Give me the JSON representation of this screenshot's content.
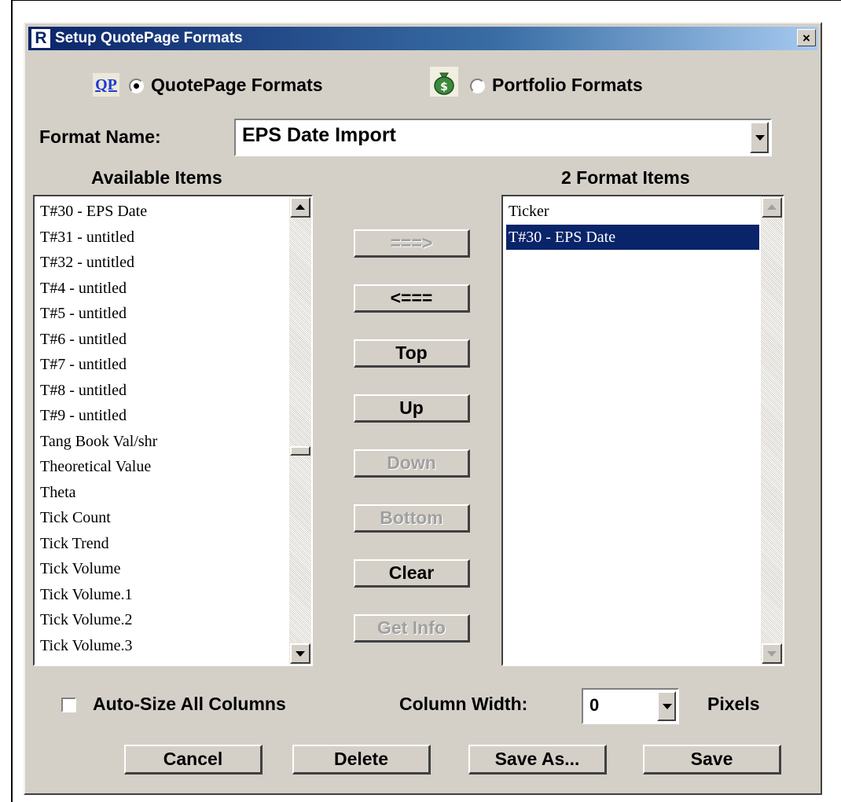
{
  "window": {
    "title": "Setup QuotePage Formats",
    "close_label": "×"
  },
  "mode": {
    "qp_icon_label": "QP",
    "quotepage_label": "QuotePage Formats",
    "portfolio_label": "Portfolio Formats",
    "selected": "quotepage"
  },
  "format_name": {
    "label": "Format Name:",
    "value": "EPS Date Import"
  },
  "available": {
    "header": "Available Items",
    "items": [
      "T#30 - EPS Date",
      "T#31 - untitled",
      "T#32 - untitled",
      "T#4 - untitled",
      "T#5 - untitled",
      "T#6 - untitled",
      "T#7 - untitled",
      "T#8 - untitled",
      "T#9 - untitled",
      "Tang Book Val/shr",
      "Theoretical Value",
      "Theta",
      "Tick Count",
      "Tick Trend",
      "Tick Volume",
      "Tick Volume.1",
      "Tick Volume.2",
      "Tick Volume.3"
    ]
  },
  "format_items": {
    "header": "2 Format Items",
    "items": [
      "Ticker",
      "T#30 - EPS Date"
    ],
    "selected_index": 1
  },
  "buttons": {
    "add": "===>",
    "remove": "<===",
    "top": "Top",
    "up": "Up",
    "down": "Down",
    "bottom": "Bottom",
    "clear": "Clear",
    "get_info": "Get Info"
  },
  "options": {
    "auto_size_label": "Auto-Size All Columns",
    "auto_size_checked": false,
    "column_width_label": "Column Width:",
    "column_width_value": "0",
    "pixels_label": "Pixels"
  },
  "footer": {
    "cancel": "Cancel",
    "delete": "Delete",
    "save_as": "Save As...",
    "save": "Save"
  }
}
